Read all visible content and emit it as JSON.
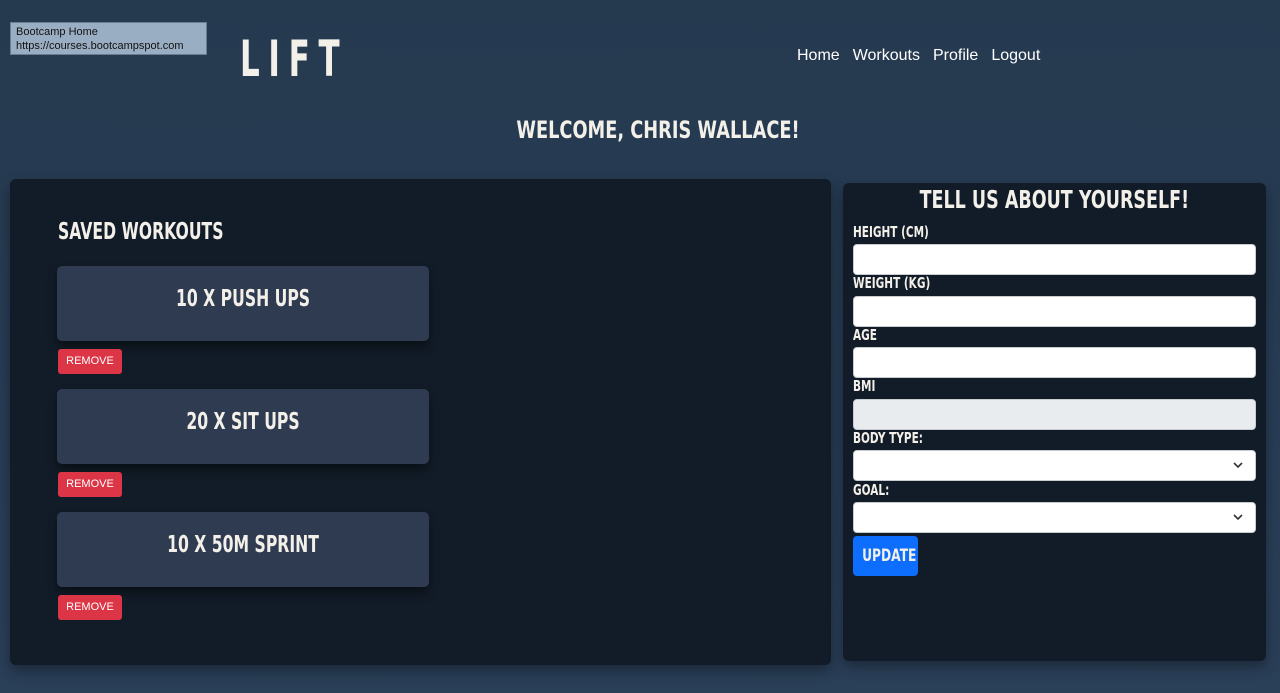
{
  "tooltip": {
    "title": "Bootcamp Home",
    "url": "https://courses.bootcampspot.com"
  },
  "header": {
    "logo": "LIFT",
    "nav": [
      "Home",
      "Workouts",
      "Profile",
      "Logout"
    ]
  },
  "welcome": "WELCOME, CHRIS WALLACE!",
  "saved": {
    "title": "SAVED WORKOUTS",
    "remove_label": "REMOVE",
    "workouts": [
      "10 X PUSH UPS",
      "20 X SIT UPS",
      "10 X 50M SPRINT"
    ]
  },
  "profile_form": {
    "title": "TELL US ABOUT YOURSELF!",
    "fields": {
      "height": "HEIGHT (CM)",
      "weight": "WEIGHT (KG)",
      "age": "AGE",
      "bmi": "BMI",
      "body_type": "BODY TYPE:",
      "goal": "GOAL:"
    },
    "values": {
      "height": "",
      "weight": "",
      "age": "",
      "bmi": "",
      "body_type": "",
      "goal": ""
    },
    "update_label": "UPDATE"
  },
  "colors": {
    "background": "#25394f",
    "panel": "#121c28",
    "card": "#2f3b50",
    "remove": "#dc3545",
    "update": "#0d6efd"
  },
  "icons": {
    "select_arrow": "chevron-down-icon"
  }
}
